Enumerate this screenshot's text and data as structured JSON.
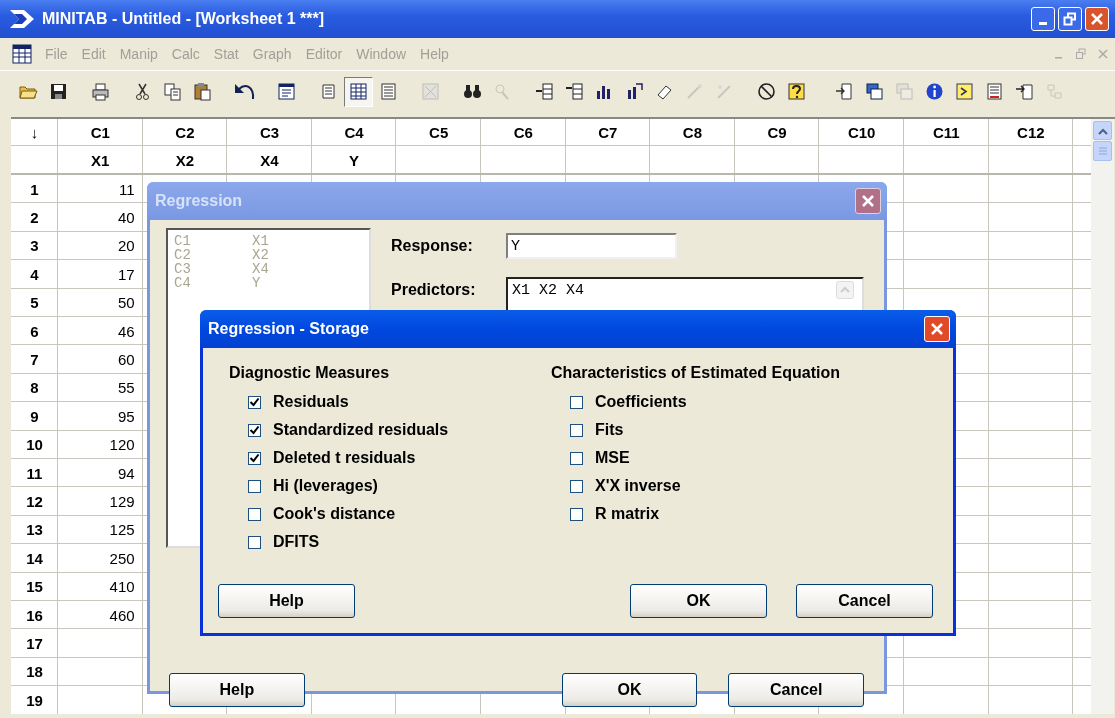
{
  "window": {
    "title": "MINITAB - Untitled - [Worksheet 1 ***]"
  },
  "menu": {
    "disabled": true,
    "items": [
      "File",
      "Edit",
      "Manip",
      "Calc",
      "Stat",
      "Graph",
      "Editor",
      "Window",
      "Help"
    ]
  },
  "toolbar": [
    {
      "selected": false,
      "disabled": false
    },
    {
      "selected": false,
      "disabled": false
    },
    {
      "selected": false,
      "disabled": false
    },
    {
      "selected": false,
      "disabled": false
    },
    {
      "selected": false,
      "disabled": false
    },
    {
      "selected": false,
      "disabled": false
    },
    {
      "selected": false,
      "disabled": false
    },
    {
      "selected": false,
      "disabled": false
    },
    {
      "selected": false,
      "disabled": false
    },
    {
      "selected": true,
      "disabled": false
    },
    {
      "selected": false,
      "disabled": false
    },
    {
      "selected": false,
      "disabled": true
    },
    {
      "selected": false,
      "disabled": false
    },
    {
      "selected": false,
      "disabled": true
    },
    {
      "selected": false,
      "disabled": false
    },
    {
      "selected": false,
      "disabled": false
    },
    {
      "selected": false,
      "disabled": false
    },
    {
      "selected": false,
      "disabled": false
    },
    {
      "selected": false,
      "disabled": false
    },
    {
      "selected": false,
      "disabled": true
    },
    {
      "selected": false,
      "disabled": true
    },
    {
      "selected": false,
      "disabled": false
    },
    {
      "selected": false,
      "disabled": false
    },
    {
      "selected": false,
      "disabled": false
    },
    {
      "selected": false,
      "disabled": false
    },
    {
      "selected": false,
      "disabled": true
    },
    {
      "selected": false,
      "disabled": false
    },
    {
      "selected": false,
      "disabled": false
    },
    {
      "selected": false,
      "disabled": false
    },
    {
      "selected": false,
      "disabled": false
    },
    {
      "selected": false,
      "disabled": true
    }
  ],
  "worksheet": {
    "corner": "↓",
    "columns": [
      {
        "id": "C1",
        "name": "X1"
      },
      {
        "id": "C2",
        "name": "X2"
      },
      {
        "id": "C3",
        "name": "X4"
      },
      {
        "id": "C4",
        "name": "Y"
      },
      {
        "id": "C5"
      },
      {
        "id": "C6"
      },
      {
        "id": "C7"
      },
      {
        "id": "C8"
      },
      {
        "id": "C9"
      },
      {
        "id": "C10"
      },
      {
        "id": "C11"
      },
      {
        "id": "C12"
      }
    ],
    "rows": [
      {
        "number": "1",
        "c1": "11"
      },
      {
        "number": "2",
        "c1": "40"
      },
      {
        "number": "3",
        "c1": "20"
      },
      {
        "number": "4",
        "c1": "17"
      },
      {
        "number": "5",
        "c1": "50"
      },
      {
        "number": "6",
        "c1": "46"
      },
      {
        "number": "7",
        "c1": "60"
      },
      {
        "number": "8",
        "c1": "55"
      },
      {
        "number": "9",
        "c1": "95"
      },
      {
        "number": "10",
        "c1": "120"
      },
      {
        "number": "11",
        "c1": "94"
      },
      {
        "number": "12",
        "c1": "129"
      },
      {
        "number": "13",
        "c1": "125"
      },
      {
        "number": "14",
        "c1": "250"
      },
      {
        "number": "15",
        "c1": "410"
      },
      {
        "number": "16",
        "c1": "460"
      },
      {
        "number": "17"
      },
      {
        "number": "18"
      },
      {
        "number": "19"
      }
    ]
  },
  "regression_dialog": {
    "title": "Regression",
    "active": false,
    "variables": [
      {
        "column": "C1",
        "name": "X1"
      },
      {
        "column": "C2",
        "name": "X2"
      },
      {
        "column": "C3",
        "name": "X4"
      },
      {
        "column": "C4",
        "name": "Y"
      }
    ],
    "response": {
      "label": "Response:",
      "value": "Y"
    },
    "predictors": {
      "label": "Predictors:",
      "value": "X1 X2 X4"
    },
    "buttons": [
      "Help",
      "OK",
      "Cancel"
    ]
  },
  "storage_dialog": {
    "title": "Regression - Storage",
    "active": true,
    "groups": [
      {
        "heading": "Diagnostic Measures",
        "options": [
          {
            "label": "Residuals",
            "checked": true
          },
          {
            "label": "Standardized residuals",
            "checked": true
          },
          {
            "label": "Deleted t residuals",
            "checked": true
          },
          {
            "label": "Hi (leverages)",
            "checked": false
          },
          {
            "label": "Cook's distance",
            "checked": false
          },
          {
            "label": "DFITS",
            "checked": false
          }
        ]
      },
      {
        "heading": "Characteristics of Estimated Equation",
        "options": [
          {
            "label": "Coefficients",
            "checked": false
          },
          {
            "label": "Fits",
            "checked": false
          },
          {
            "label": "MSE",
            "checked": false
          },
          {
            "label": "X'X inverse",
            "checked": false
          },
          {
            "label": "R matrix",
            "checked": false
          }
        ]
      }
    ],
    "buttons": [
      "Help",
      "OK",
      "Cancel"
    ]
  }
}
